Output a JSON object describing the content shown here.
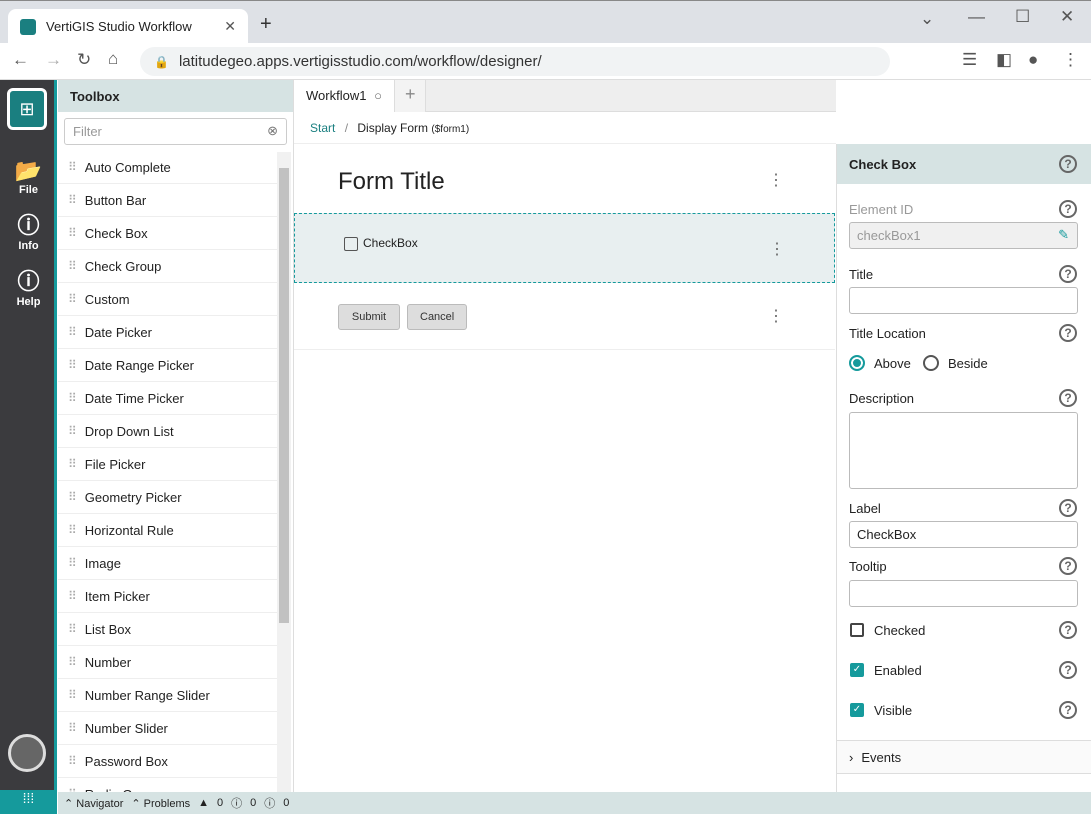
{
  "browser": {
    "tab_title": "VertiGIS Studio Workflow",
    "url": "latitudegeo.apps.vertigisstudio.com/workflow/designer/"
  },
  "rail": [
    {
      "label": "File",
      "icon": "folder-icon"
    },
    {
      "label": "Info",
      "icon": "info-icon"
    },
    {
      "label": "Help",
      "icon": "help-icon"
    }
  ],
  "toolbox": {
    "title": "Toolbox",
    "filter_placeholder": "Filter",
    "items": [
      "Auto Complete",
      "Button Bar",
      "Check Box",
      "Check Group",
      "Custom",
      "Date Picker",
      "Date Range Picker",
      "Date Time Picker",
      "Drop Down List",
      "File Picker",
      "Geometry Picker",
      "Horizontal Rule",
      "Image",
      "Item Picker",
      "List Box",
      "Number",
      "Number Range Slider",
      "Number Slider",
      "Password Box",
      "Radio Group"
    ]
  },
  "workspace": {
    "tab": "Workflow1",
    "breadcrumb_start": "Start",
    "breadcrumb_current": "Display Form",
    "breadcrumb_id": "($form1)"
  },
  "form": {
    "title": "Form Title",
    "checkbox_label": "CheckBox",
    "submit": "Submit",
    "cancel": "Cancel"
  },
  "props": {
    "header": "Check Box",
    "element_id_label": "Element ID",
    "element_id": "checkBox1",
    "title_label": "Title",
    "title_value": "",
    "title_location_label": "Title Location",
    "above": "Above",
    "beside": "Beside",
    "title_location": "Above",
    "description_label": "Description",
    "label_label": "Label",
    "label_value": "CheckBox",
    "tooltip_label": "Tooltip",
    "checked_label": "Checked",
    "checked": false,
    "enabled_label": "Enabled",
    "enabled": true,
    "visible_label": "Visible",
    "visible": true,
    "events_label": "Events"
  },
  "status": {
    "navigator": "Navigator",
    "problems": "Problems",
    "warnings": "0",
    "errors": "0",
    "infos": "0"
  },
  "colors": {
    "accent": "#159a9c",
    "header_bg": "#d6e3e3",
    "rail_bg": "#3b3b3e"
  }
}
